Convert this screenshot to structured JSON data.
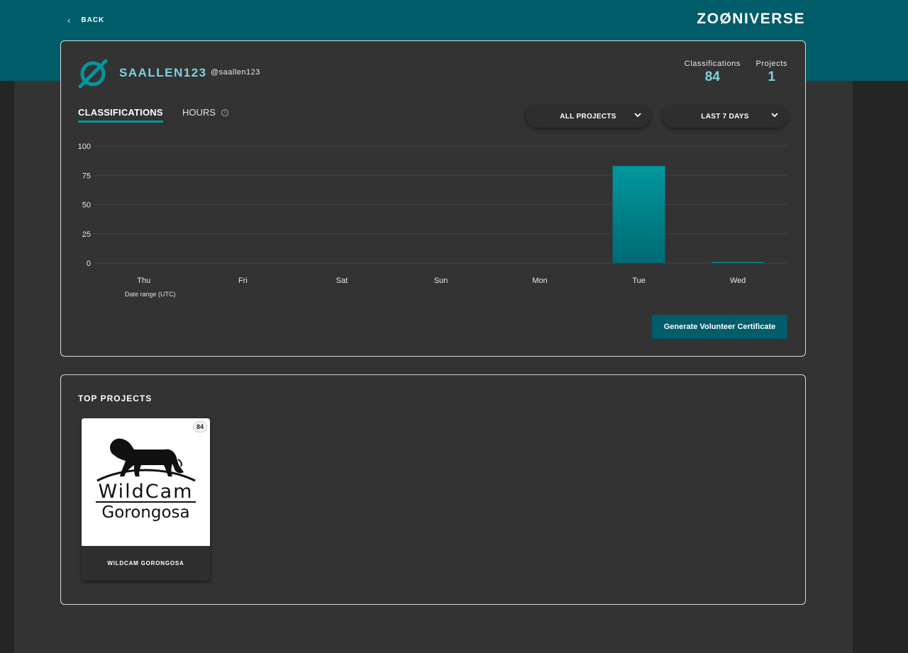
{
  "header": {
    "back_label": "BACK",
    "logo_text": "ZOØNIVERSE"
  },
  "user": {
    "display_name": "SAALLEN123",
    "handle": "@saallen123"
  },
  "stats": {
    "classifications_label": "Classifications",
    "classifications_value": "84",
    "projects_label": "Projects",
    "projects_value": "1"
  },
  "tabs": {
    "classifications": "CLASSIFICATIONS",
    "hours": "HOURS"
  },
  "filters": {
    "project": "ALL PROJECTS",
    "range": "LAST 7 DAYS"
  },
  "chart_data": {
    "type": "bar",
    "categories": [
      "Thu",
      "Fri",
      "Sat",
      "Sun",
      "Mon",
      "Tue",
      "Wed"
    ],
    "values": [
      0,
      0,
      0,
      0,
      0,
      83,
      1
    ],
    "ylim": [
      0,
      100
    ],
    "yticks": [
      0,
      25,
      50,
      75,
      100
    ],
    "xlabel": "Date range (UTC)",
    "grid": true,
    "bar_color": "#00979d"
  },
  "certificate_button": "Generate Volunteer Certificate",
  "top_projects": {
    "heading": "TOP PROJECTS",
    "items": [
      {
        "name": "WILDCAM GORONGOSA",
        "count": "84",
        "logo_line1": "WildCam",
        "logo_line2": "Gorongosa"
      }
    ]
  },
  "colors": {
    "brand": "#005d69",
    "accent": "#7dd3dc",
    "bar": "#00979d"
  }
}
